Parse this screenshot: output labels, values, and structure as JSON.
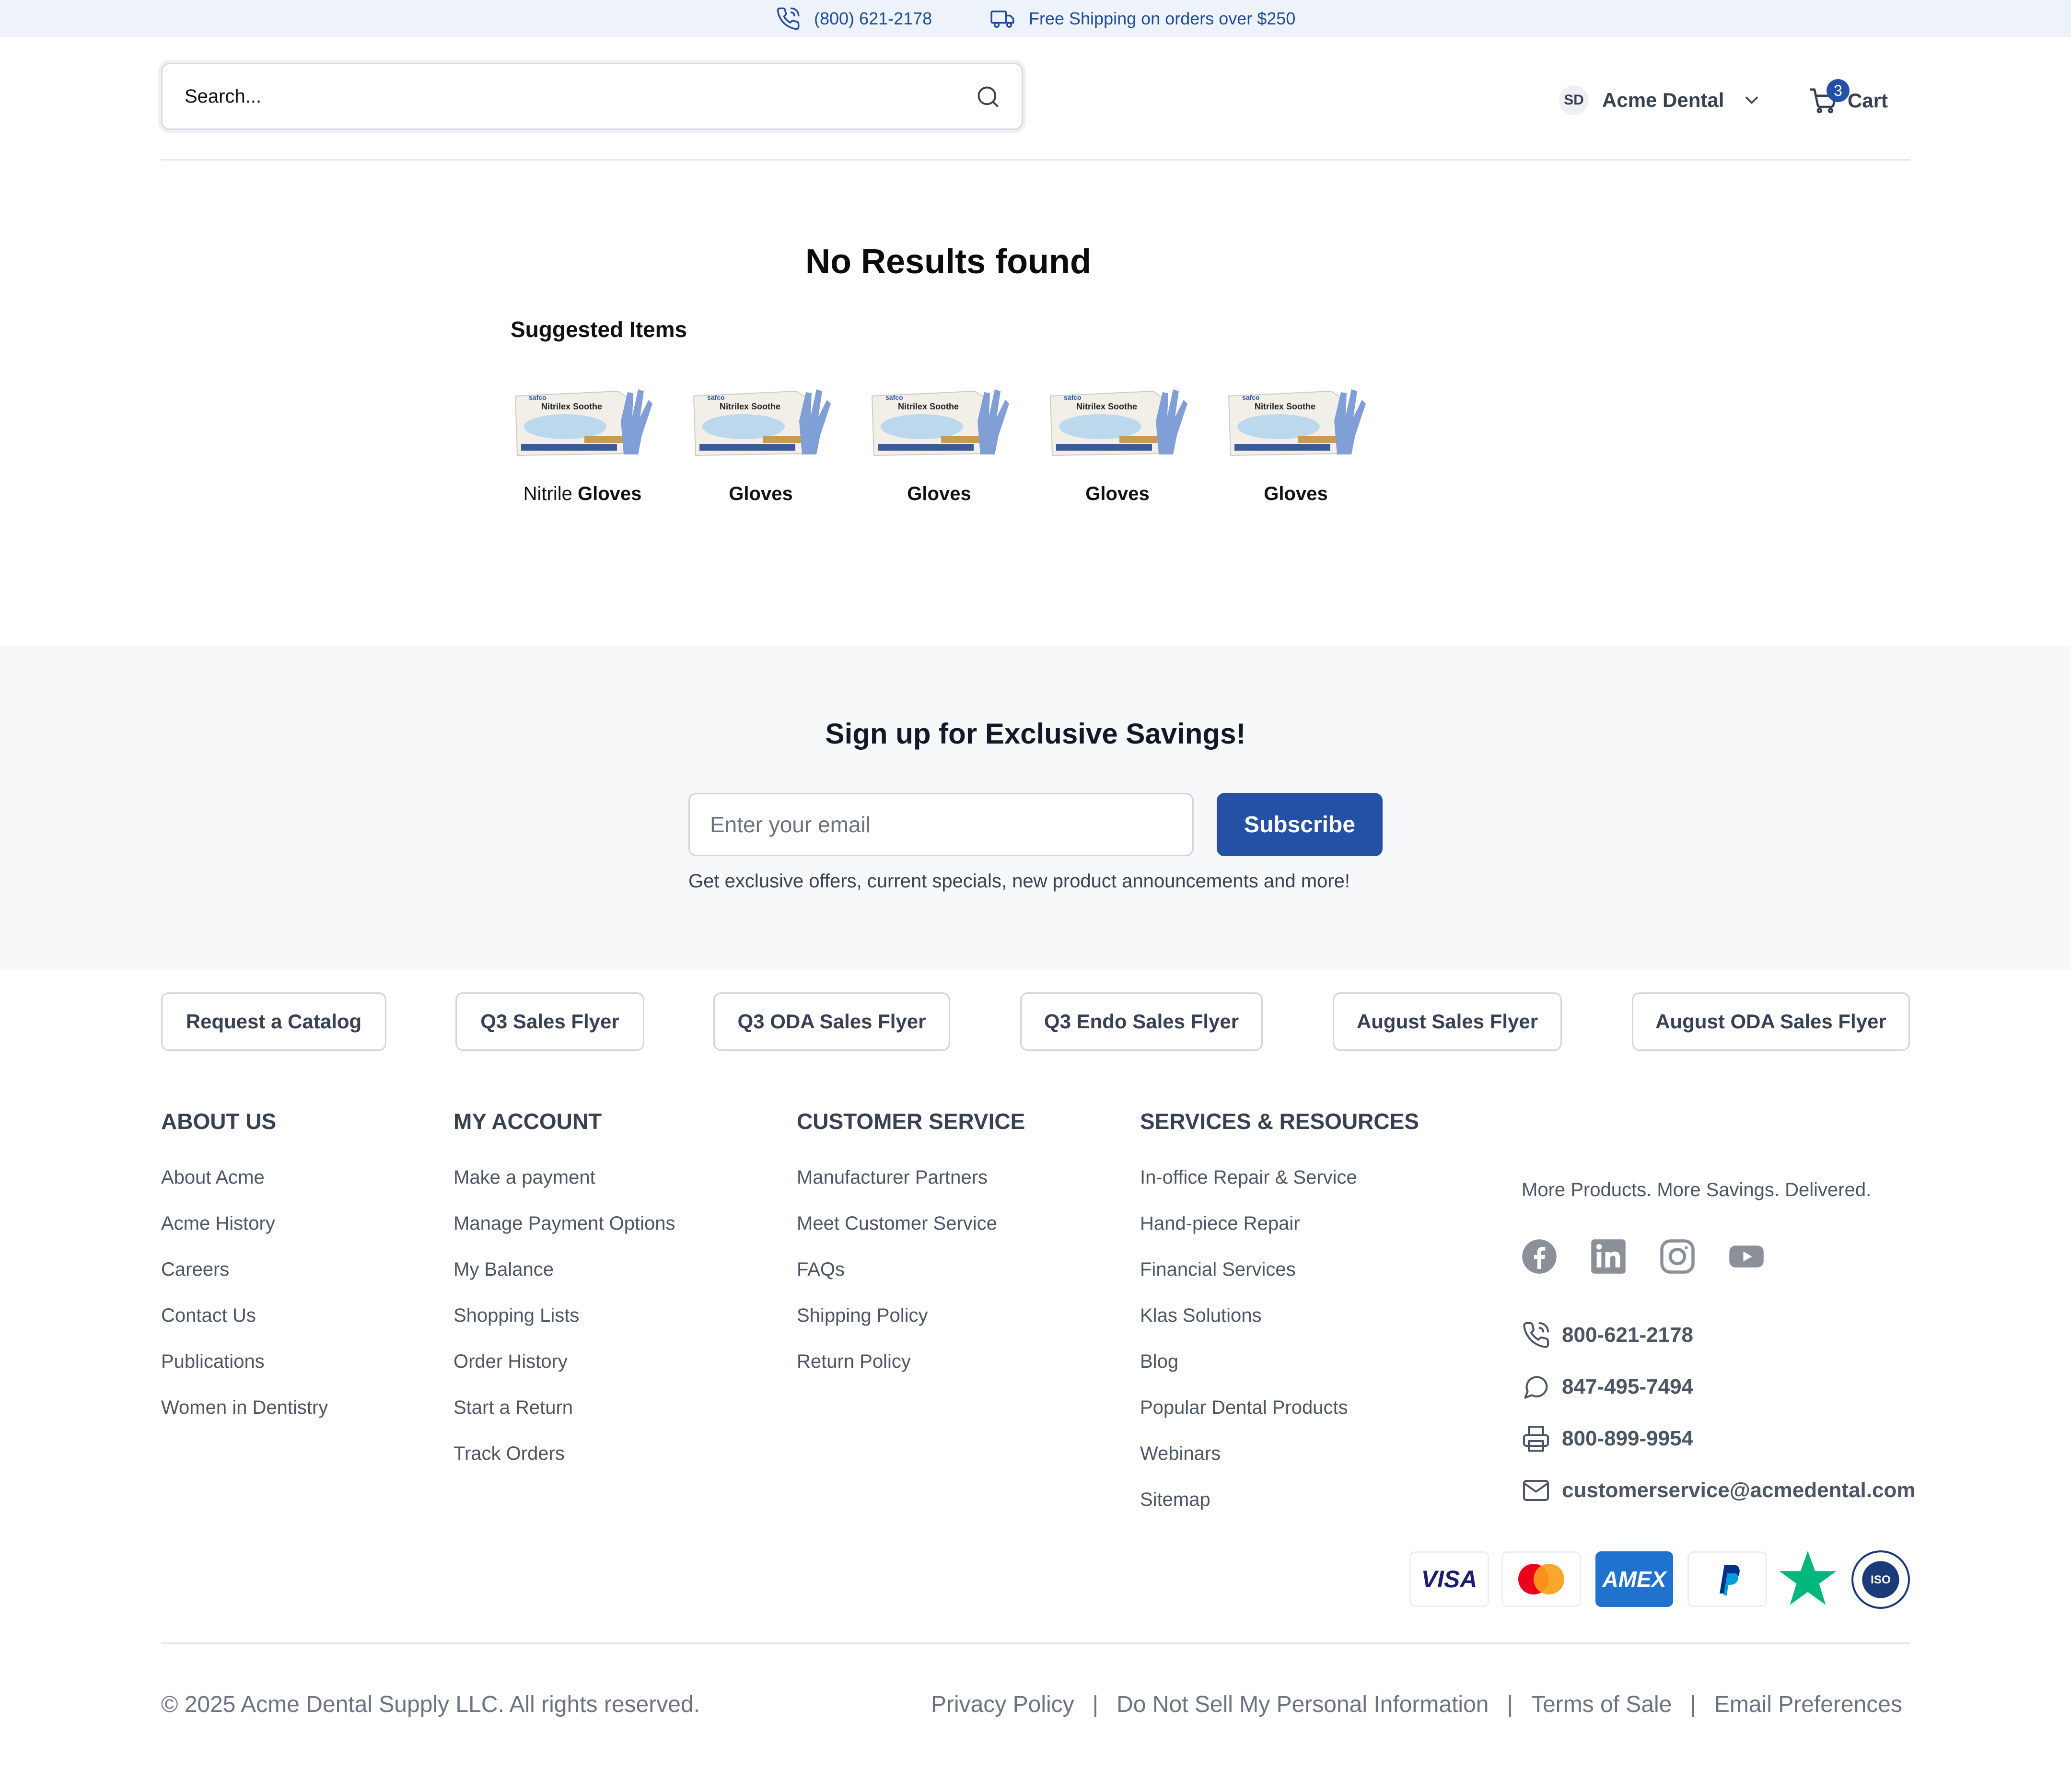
{
  "topbar": {
    "phone": "(800) 621-2178",
    "shipping": "Free Shipping on orders over $250"
  },
  "header": {
    "search_placeholder": "Search...",
    "account_initials": "SD",
    "account_name": "Acme Dental",
    "cart_count": "3",
    "cart_label": "Cart"
  },
  "main": {
    "title": "No Results found",
    "suggested_heading": "Suggested Items",
    "products": [
      {
        "name_prefix": "Nitrile ",
        "name_bold": "Gloves",
        "box_brand": "safco",
        "box_label": "Nitrilex Soothe"
      },
      {
        "name_prefix": "",
        "name_bold": "Gloves",
        "box_brand": "safco",
        "box_label": "Nitrilex Soothe"
      },
      {
        "name_prefix": "",
        "name_bold": "Gloves",
        "box_brand": "safco",
        "box_label": "Nitrilex Soothe"
      },
      {
        "name_prefix": "",
        "name_bold": "Gloves",
        "box_brand": "safco",
        "box_label": "Nitrilex Soothe"
      },
      {
        "name_prefix": "",
        "name_bold": "Gloves",
        "box_brand": "safco",
        "box_label": "Nitrilex Soothe"
      }
    ]
  },
  "newsletter": {
    "title": "Sign up for Exclusive Savings!",
    "email_placeholder": "Enter your email",
    "button": "Subscribe",
    "note": "Get exclusive offers, current specials, new product announcements and more!"
  },
  "flyers": [
    "Request a Catalog",
    "Q3 Sales Flyer",
    "Q3 ODA Sales Flyer",
    "Q3 Endo Sales Flyer",
    "August Sales Flyer",
    "August ODA Sales Flyer"
  ],
  "footer": {
    "columns": [
      {
        "title": "ABOUT US",
        "links": [
          "About Acme",
          "Acme History",
          "Careers",
          "Contact Us",
          "Publications",
          "Women in Dentistry"
        ]
      },
      {
        "title": "MY ACCOUNT",
        "links": [
          "Make a payment",
          "Manage Payment Options",
          "My Balance",
          "Shopping Lists",
          "Order History",
          "Start a Return",
          "Track Orders"
        ]
      },
      {
        "title": "CUSTOMER SERVICE",
        "links": [
          "Manufacturer Partners",
          "Meet Customer Service",
          "FAQs",
          "Shipping Policy",
          "Return Policy"
        ]
      },
      {
        "title": "SERVICES & RESOURCES",
        "links": [
          "In-office Repair & Service",
          "Hand-piece Repair",
          "Financial Services",
          "Klas Solutions",
          "Blog",
          "Popular Dental Products",
          "Webinars",
          "Sitemap"
        ]
      }
    ],
    "tagline": "More Products. More Savings. Delivered.",
    "social": [
      "facebook-icon",
      "linkedin-icon",
      "instagram-icon",
      "youtube-icon"
    ],
    "contacts": [
      {
        "icon": "phone-icon",
        "text": "800-621-2178"
      },
      {
        "icon": "chat-icon",
        "text": "847-495-7494"
      },
      {
        "icon": "printer-icon",
        "text": "800-899-9954"
      },
      {
        "icon": "mail-icon",
        "text": "customerservice@acmedental.com"
      }
    ],
    "payments": {
      "visa": "VISA",
      "amex": "AMEX",
      "iso": "ISO"
    },
    "copyright": "© 2025 Acme Dental Supply LLC. All rights reserved.",
    "legal": [
      "Privacy Policy",
      "Do Not Sell My Personal Information",
      "Terms of Sale",
      "Email Preferences"
    ],
    "legal_separator": "|"
  },
  "colors": {
    "brand": "#2451a5",
    "topbar_bg": "#eef2fa",
    "newsletter_bg": "#f7f8fa"
  }
}
